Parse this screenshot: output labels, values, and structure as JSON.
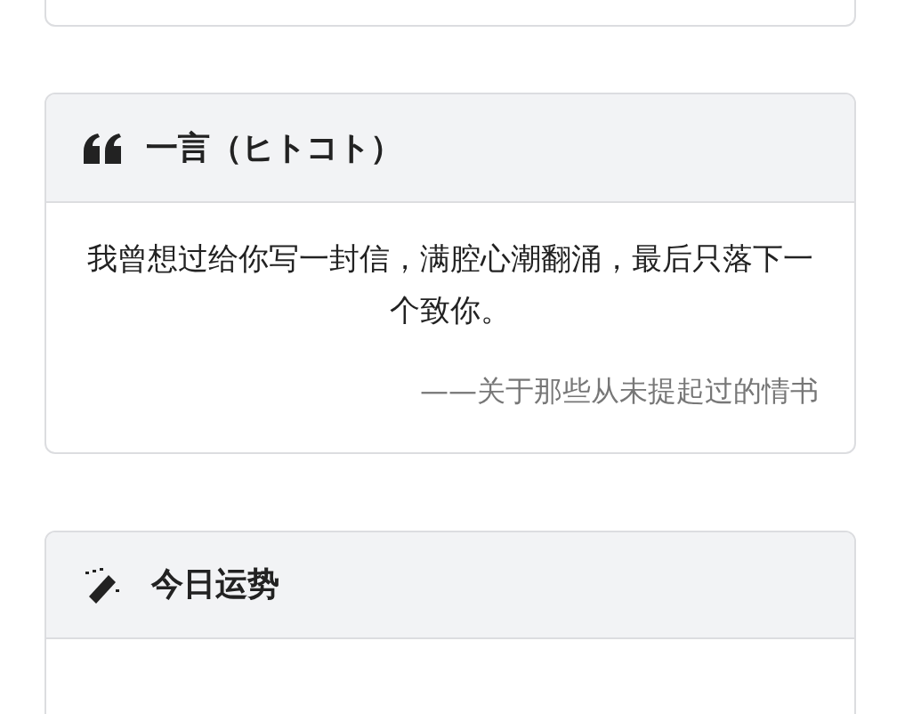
{
  "hitokoto_card": {
    "title": "一言（ヒトコト）",
    "quote": "我曾想过给你写一封信，满腔心潮翻涌，最后只落下一个致你。",
    "source": "——关于那些从未提起过的情书"
  },
  "fortune_card": {
    "title": "今日运势"
  }
}
